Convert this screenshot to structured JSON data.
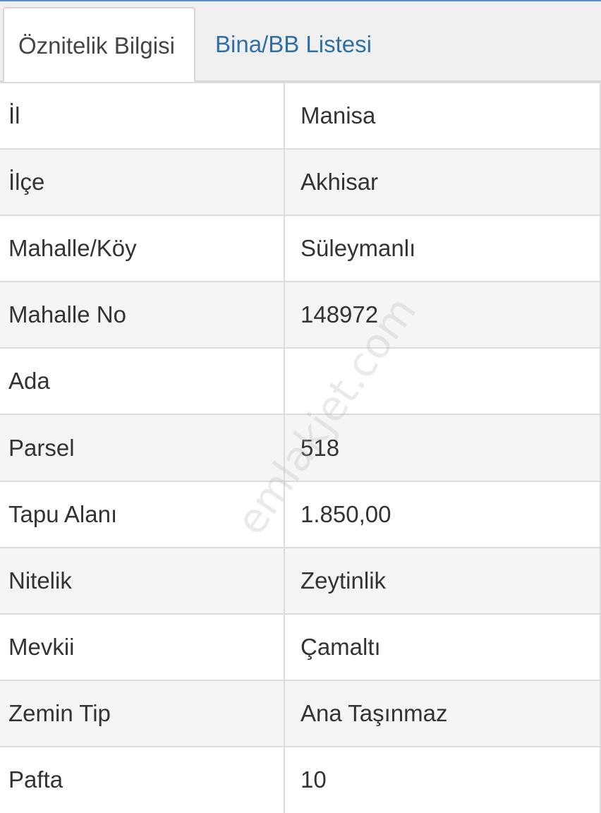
{
  "tabs": [
    {
      "label": "Öznitelik Bilgisi",
      "active": true
    },
    {
      "label": "Bina/BB Listesi",
      "active": false
    }
  ],
  "rows": [
    {
      "label": "İl",
      "value": "Manisa"
    },
    {
      "label": "İlçe",
      "value": "Akhisar"
    },
    {
      "label": "Mahalle/Köy",
      "value": "Süleymanlı"
    },
    {
      "label": "Mahalle No",
      "value": "148972"
    },
    {
      "label": "Ada",
      "value": ""
    },
    {
      "label": "Parsel",
      "value": "518"
    },
    {
      "label": "Tapu Alanı",
      "value": "1.850,00"
    },
    {
      "label": "Nitelik",
      "value": "Zeytinlik"
    },
    {
      "label": "Mevkii",
      "value": "Çamaltı"
    },
    {
      "label": "Zemin Tip",
      "value": "Ana Taşınmaz"
    },
    {
      "label": "Pafta",
      "value": "10"
    }
  ],
  "watermark": "emlakjet.com",
  "colors": {
    "accent": "#2f6fa8",
    "border": "#dcdcdc",
    "stripe": "#f5f5f5"
  }
}
